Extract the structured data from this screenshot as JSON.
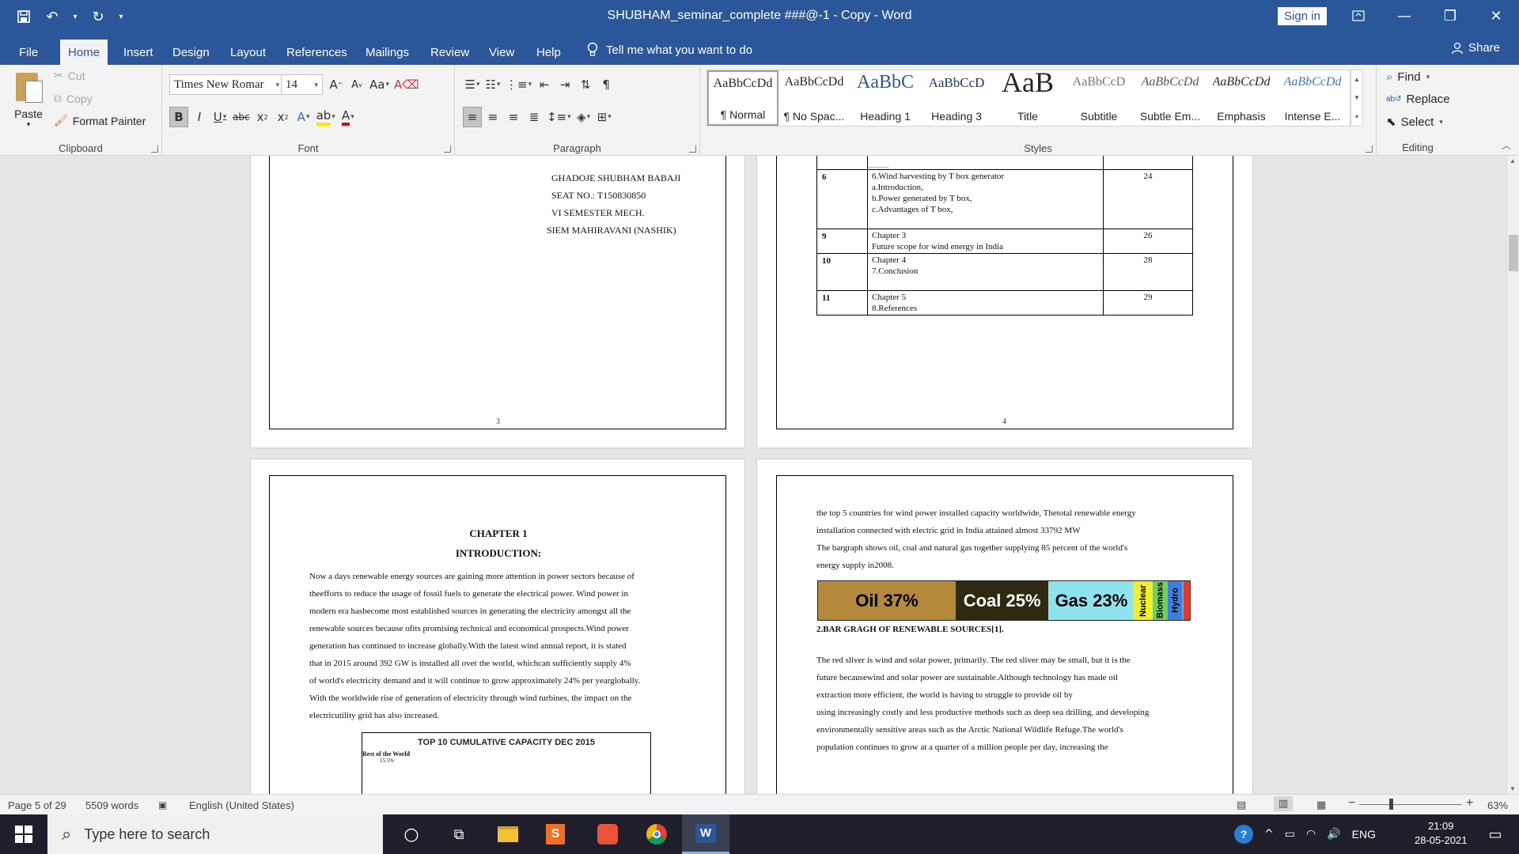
{
  "window": {
    "title": "SHUBHAM_seminar_complete ###@-1 - Copy  -  Word",
    "sign_in": "Sign in"
  },
  "menu": {
    "tabs": [
      "File",
      "Home",
      "Insert",
      "Design",
      "Layout",
      "References",
      "Mailings",
      "Review",
      "View",
      "Help"
    ],
    "tell_me": "Tell me what you want to do",
    "share": "Share"
  },
  "ribbon": {
    "clipboard": {
      "label": "Clipboard",
      "paste": "Paste",
      "cut": "Cut",
      "copy": "Copy",
      "format_painter": "Format Painter"
    },
    "font": {
      "label": "Font",
      "name": "Times New Romar",
      "size": "14"
    },
    "paragraph": {
      "label": "Paragraph"
    },
    "styles": {
      "label": "Styles",
      "items": [
        {
          "sample": "AaBbCcDd",
          "name": "¶ Normal"
        },
        {
          "sample": "AaBbCcDd",
          "name": "¶ No Spac..."
        },
        {
          "sample": "AaBbC",
          "name": "Heading 1"
        },
        {
          "sample": "AaBbCcD",
          "name": "Heading 3"
        },
        {
          "sample": "AaB",
          "name": "Title"
        },
        {
          "sample": "AaBbCcD",
          "name": "Subtitle"
        },
        {
          "sample": "AaBbCcDd",
          "name": "Subtle Em..."
        },
        {
          "sample": "AaBbCcDd",
          "name": "Emphasis"
        },
        {
          "sample": "AaBbCcDd",
          "name": "Intense E..."
        }
      ]
    },
    "editing": {
      "label": "Editing",
      "find": "Find",
      "replace": "Replace",
      "select": "Select"
    }
  },
  "page3": {
    "lines": [
      "GHADOJE SHUBHAM BABAJI",
      "SEAT NO.: T150830850",
      "VI SEMESTER MECH.",
      "SIEM MAHIRAVANI (NASHIK)"
    ],
    "number": "3"
  },
  "page4": {
    "rows": [
      {
        "no": "6",
        "content": [
          "6.Wind harvesting by T box generator",
          "a.Introduction,",
          "b.Power generated by T box,",
          "c.Advantages of T box,"
        ],
        "page": "24"
      },
      {
        "no": "9",
        "content": [
          "Chapter 3",
          "Future scope for wind energy in India"
        ],
        "page": "26"
      },
      {
        "no": "10",
        "content": [
          "Chapter 4",
          "7.Conclusion"
        ],
        "page": "28"
      },
      {
        "no": "11",
        "content": [
          "Chapter 5",
          "8.References"
        ],
        "page": "29"
      }
    ],
    "number": "4"
  },
  "page5": {
    "chapter": "CHAPTER 1",
    "heading": "INTRODUCTION:",
    "lines": [
      "Now a days renewable energy sources are gaining more attention in power sectors because of",
      "theefforts to reduce the usage of fossil fuels to generate the electrical power. Wind power in",
      "modern era hasbecome most established sources in generating the electricity amongst all the",
      "renewable sources because ofits promising technical and economical prospects.Wind power",
      "generation has continued to increase globally.With the latest wind annual report, it is stated",
      "that in 2015 around 392 GW is installed all over the world, whichcan sufficiently supply 4%",
      "of world's electricity demand and it will continue to grow approximately 24% per yearglobally.",
      "With the worldwide rise of generation of electricity through wind turbines, the impact on the",
      "electricutility grid has also increased."
    ],
    "figure_title": "TOP 10 CUMULATIVE  CAPACITY DEC 2015",
    "figure_label": "Rest of the World",
    "figure_pct": "15.5%"
  },
  "page6": {
    "top_lines": [
      "the top 5 countries for wind power installed capacity worldwide, Thetotal renewable energy",
      "installation connected with electric grid in India attained almost 33792 MW",
      "The bargraph shows oil, coal and natural gas together supplying 85 percent of the world's",
      "energy supply in2008."
    ],
    "bar_segments": [
      {
        "label": "Oil 37%",
        "share": 37,
        "color": "#b5893b"
      },
      {
        "label": "Coal 25%",
        "share": 25,
        "color": "#2e2a10"
      },
      {
        "label": "Gas 23%",
        "share": 23,
        "color": "#8de3ee"
      },
      {
        "label": "Nuclear",
        "share": 5,
        "color": "#f2ee2a"
      },
      {
        "label": "Biomass",
        "share": 4,
        "color": "#6dd15a"
      },
      {
        "label": "Hydro",
        "share": 4,
        "color": "#3d7fe0"
      },
      {
        "label": "",
        "share": 2,
        "color": "#e03a2a"
      }
    ],
    "caption": "2.BAR GRAGH OF RENEWABLE SOURCES[1].",
    "body_lines": [
      "The red sliver is wind and solar power, primarily. The red sliver may be small, but it is the",
      "future becausewind and solar power are sustainable.Although technology has made oil",
      "extraction more efficient, the world is having to struggle to provide oil by",
      "using increasingly costly and less productive methods such as deep sea drilling, and developing",
      "environmentally sensitive areas such as the Arctic National Wildlife Refuge.The world's",
      "population continues to grow at a quarter of a million people per day, increasing the"
    ]
  },
  "status": {
    "page": "Page 5 of 29",
    "words": "5509 words",
    "language": "English (United States)",
    "zoom": "63%"
  },
  "taskbar": {
    "search": "Type here to search",
    "lang": "ENG",
    "time": "21:09",
    "date": "28-05-2021"
  }
}
